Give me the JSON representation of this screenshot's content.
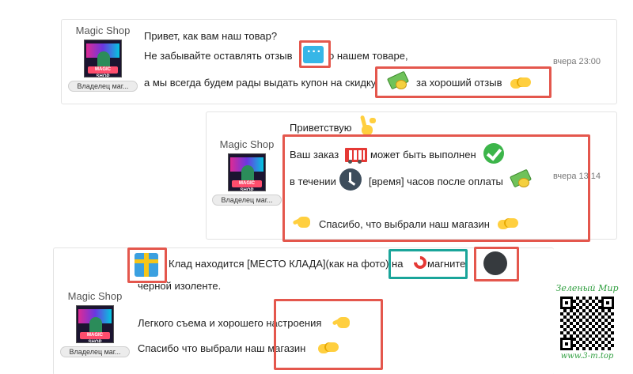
{
  "messages": [
    {
      "sender": "Magic Shop",
      "avatar_text": "MAGIC SHOP",
      "role": "Владелец маг...",
      "lines": [
        "Привет, как вам наш товар?",
        "Не забывайте оставлять отзыв",
        "о нашем товаре,",
        "а мы всегда будем рады выдать купон на скидку",
        "за хороший отзыв"
      ],
      "time": "вчера 23:00",
      "emojis": [
        "speech-bubble-icon",
        "money-icon",
        "handshake-icon"
      ]
    },
    {
      "sender": "Magic Shop",
      "avatar_text": "MAGIC SHOP",
      "role": "Владелец маг...",
      "lines": [
        "Приветствую",
        "Ваш заказ",
        "может быть выполнен",
        "в течении",
        "[время] часов после оплаты",
        "Спасибо, что выбрали наш магазин"
      ],
      "time": "вчера 13:14",
      "emojis": [
        "victory-hand-icon",
        "shopping-cart-icon",
        "check-mark-icon",
        "clock-icon",
        "money-icon",
        "pointing-hand-icon",
        "handshake-icon"
      ]
    },
    {
      "sender": "Magic Shop",
      "avatar_text": "MAGIC SHOP",
      "role": "Владелец маг...",
      "lines": [
        "Клад находится [МЕСТО КЛАДА](как на фото) на",
        "магните",
        "черной изоленте.",
        "Легкого съема и хорошего настроения",
        "Спасибо что выбрали наш магазин"
      ],
      "emojis": [
        "gift-icon",
        "magnet-icon",
        "black-circle-icon",
        "pointing-hand-icon",
        "handshake-icon"
      ]
    }
  ],
  "watermark": {
    "title": "Зеленый Мир",
    "url": "www.3-m.top"
  },
  "colors": {
    "highlight_red": "#e4574d",
    "highlight_teal": "#1aa59a",
    "watermark_green": "#2e9e3e"
  }
}
